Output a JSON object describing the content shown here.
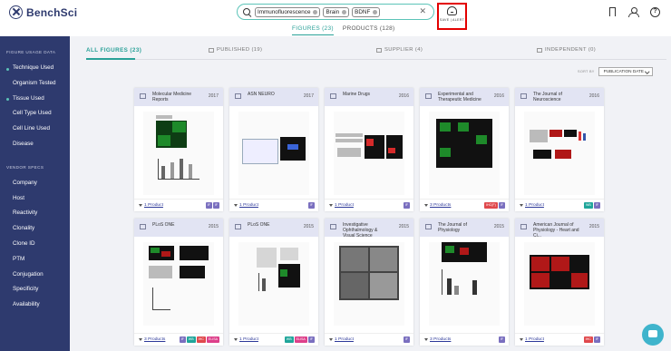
{
  "app": {
    "logo_text": "BenchSci"
  },
  "search": {
    "chips": [
      "Immunofluorescence",
      "Brain",
      "BDNF"
    ]
  },
  "alert": {
    "label": "SAVE | ALERT"
  },
  "result_tabs": [
    {
      "label": "FIGURES (23)",
      "active": true
    },
    {
      "label": "PRODUCTS (128)",
      "active": false
    }
  ],
  "sidebar": {
    "usage_heading": "FIGURE USAGE DATA",
    "usage_items": [
      "Technique Used",
      "Organism Tested",
      "Tissue Used",
      "Cell Type Used",
      "Cell Line Used",
      "Disease"
    ],
    "vendor_heading": "VENDOR SPECS",
    "vendor_items": [
      "Company",
      "Host",
      "Reactivity",
      "Clonality",
      "Clone ID",
      "PTM",
      "Conjugation",
      "Specificity",
      "Availability"
    ]
  },
  "filter_tabs": {
    "all": "ALL FIGURES (23)",
    "published": "PUBLISHED (19)",
    "supplier": "SUPPLIER (4)",
    "independent": "INDEPENDENT (0)"
  },
  "sort": {
    "label": "SORT BY",
    "value": "PUBLICATION DATE"
  },
  "cards": [
    {
      "title": "Molecular Medicine Reports",
      "year": "2017",
      "products": "1 Product",
      "tags": [
        {
          "t": "IF",
          "c": "purple"
        },
        {
          "t": "IF",
          "c": "purple"
        }
      ]
    },
    {
      "title": "ASN NEURO",
      "year": "2017",
      "products": "1 Product",
      "tags": [
        {
          "t": "IF",
          "c": "purple"
        }
      ]
    },
    {
      "title": "Marine Drugs",
      "year": "2016",
      "products": "1 Product",
      "tags": [
        {
          "t": "IF",
          "c": "purple"
        }
      ]
    },
    {
      "title": "Experimental and Therapeutic Medicine",
      "year": "2016",
      "products": "3 Products",
      "tags": [
        {
          "t": "IHC(F)",
          "c": "red"
        },
        {
          "t": "IF",
          "c": "purple"
        }
      ]
    },
    {
      "title": "The Journal of Neuroscience",
      "year": "2016",
      "products": "1 Product",
      "tags": [
        {
          "t": "WB",
          "c": "teal"
        },
        {
          "t": "IF",
          "c": "purple"
        }
      ]
    },
    {
      "title": "PLoS ONE",
      "year": "2015",
      "products": "3 Products",
      "tags": [
        {
          "t": "IF",
          "c": "purple"
        },
        {
          "t": "WB",
          "c": "teal"
        },
        {
          "t": "IHC",
          "c": "red"
        },
        {
          "t": "ELISA",
          "c": "pink"
        }
      ]
    },
    {
      "title": "PLoS ONE",
      "year": "2015",
      "products": "1 Product",
      "tags": [
        {
          "t": "WB",
          "c": "teal"
        },
        {
          "t": "ELISA",
          "c": "pink"
        },
        {
          "t": "IF",
          "c": "purple"
        }
      ]
    },
    {
      "title": "Investigative Ophthalmology & Visual Science",
      "year": "2015",
      "products": "1 Product",
      "tags": [
        {
          "t": "IF",
          "c": "purple"
        }
      ]
    },
    {
      "title": "The Journal of Physiology",
      "year": "2015",
      "products": "3 Products",
      "tags": [
        {
          "t": "IF",
          "c": "purple"
        }
      ]
    },
    {
      "title": "American Journal of Physiology - Heart and Ci...",
      "year": "2015",
      "products": "1 Product",
      "tags": [
        {
          "t": "IHC",
          "c": "red"
        },
        {
          "t": "IF",
          "c": "purple"
        }
      ]
    }
  ]
}
